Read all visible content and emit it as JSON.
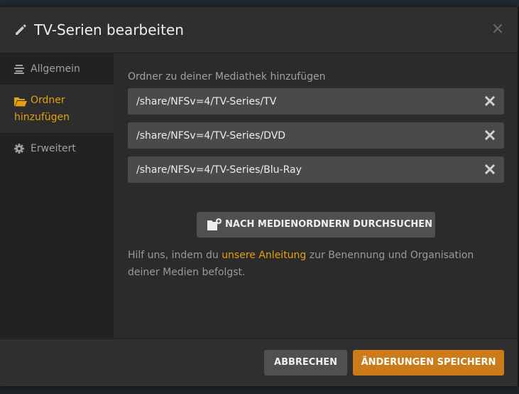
{
  "dialog": {
    "title": "TV-Serien bearbeiten",
    "close_label": "×"
  },
  "sidebar": {
    "items": [
      {
        "label": "Allgemein",
        "icon": "list-icon",
        "active": false
      },
      {
        "label": "Ordner hinzufügen",
        "icon": "folder-open-icon",
        "active": true
      },
      {
        "label": "Erweitert",
        "icon": "gear-icon",
        "active": false
      }
    ]
  },
  "main": {
    "section_label": "Ordner zu deiner Mediathek hinzufügen",
    "folders": [
      "/share/NFSv=4/TV-Series/TV",
      "/share/NFSv=4/TV-Series/DVD",
      "/share/NFSv=4/TV-Series/Blu-Ray"
    ],
    "browse_label": "NACH MEDIENORDNERN DURCHSUCHEN",
    "help": {
      "before": "Hilf uns, indem du ",
      "link": "unsere Anleitung",
      "after": " zur Benennung und Organisation deiner Medien befolgst."
    }
  },
  "footer": {
    "cancel_label": "ABBRECHEN",
    "save_label": "ÄNDERUNGEN SPEICHERN"
  },
  "colors": {
    "accent": "#e5a00d",
    "save_button": "#cc7b19",
    "panel": "#2b2b2b",
    "sidebar": "#222222"
  }
}
